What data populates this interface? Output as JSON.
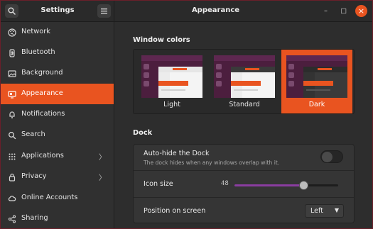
{
  "header": {
    "app_title": "Settings",
    "page_title": "Appearance",
    "search_icon": "search-icon",
    "menu_icon": "hamburger-menu-icon",
    "minimize_glyph": "–",
    "maximize_glyph": "□",
    "close_glyph": "×"
  },
  "sidebar": {
    "items": [
      {
        "label": "Network",
        "icon": "network-icon",
        "chevron": ""
      },
      {
        "label": "Bluetooth",
        "icon": "bluetooth-icon",
        "chevron": ""
      },
      {
        "label": "Background",
        "icon": "background-icon",
        "chevron": ""
      },
      {
        "label": "Appearance",
        "icon": "appearance-icon",
        "chevron": "",
        "active": true
      },
      {
        "label": "Notifications",
        "icon": "bell-icon",
        "chevron": ""
      },
      {
        "label": "Search",
        "icon": "search-icon",
        "chevron": ""
      },
      {
        "label": "Applications",
        "icon": "apps-grid-icon",
        "chevron": "〉"
      },
      {
        "label": "Privacy",
        "icon": "lock-icon",
        "chevron": "〉"
      },
      {
        "label": "Online Accounts",
        "icon": "cloud-icon",
        "chevron": ""
      },
      {
        "label": "Sharing",
        "icon": "share-icon",
        "chevron": ""
      }
    ]
  },
  "window_colors": {
    "title": "Window colors",
    "options": [
      {
        "label": "Light",
        "selected": false
      },
      {
        "label": "Standard",
        "selected": false
      },
      {
        "label": "Dark",
        "selected": true
      }
    ]
  },
  "dock": {
    "title": "Dock",
    "autohide": {
      "label": "Auto-hide the Dock",
      "description": "The dock hides when any windows overlap with it.",
      "enabled": false
    },
    "icon_size": {
      "label": "Icon size",
      "value": "48",
      "min": 16,
      "max": 64
    },
    "position": {
      "label": "Position on screen",
      "value": "Left",
      "chevron": "▼"
    }
  },
  "colors": {
    "accent": "#e95420",
    "aubergine": "#5e2750",
    "slider_fill": "#8a3da0"
  }
}
